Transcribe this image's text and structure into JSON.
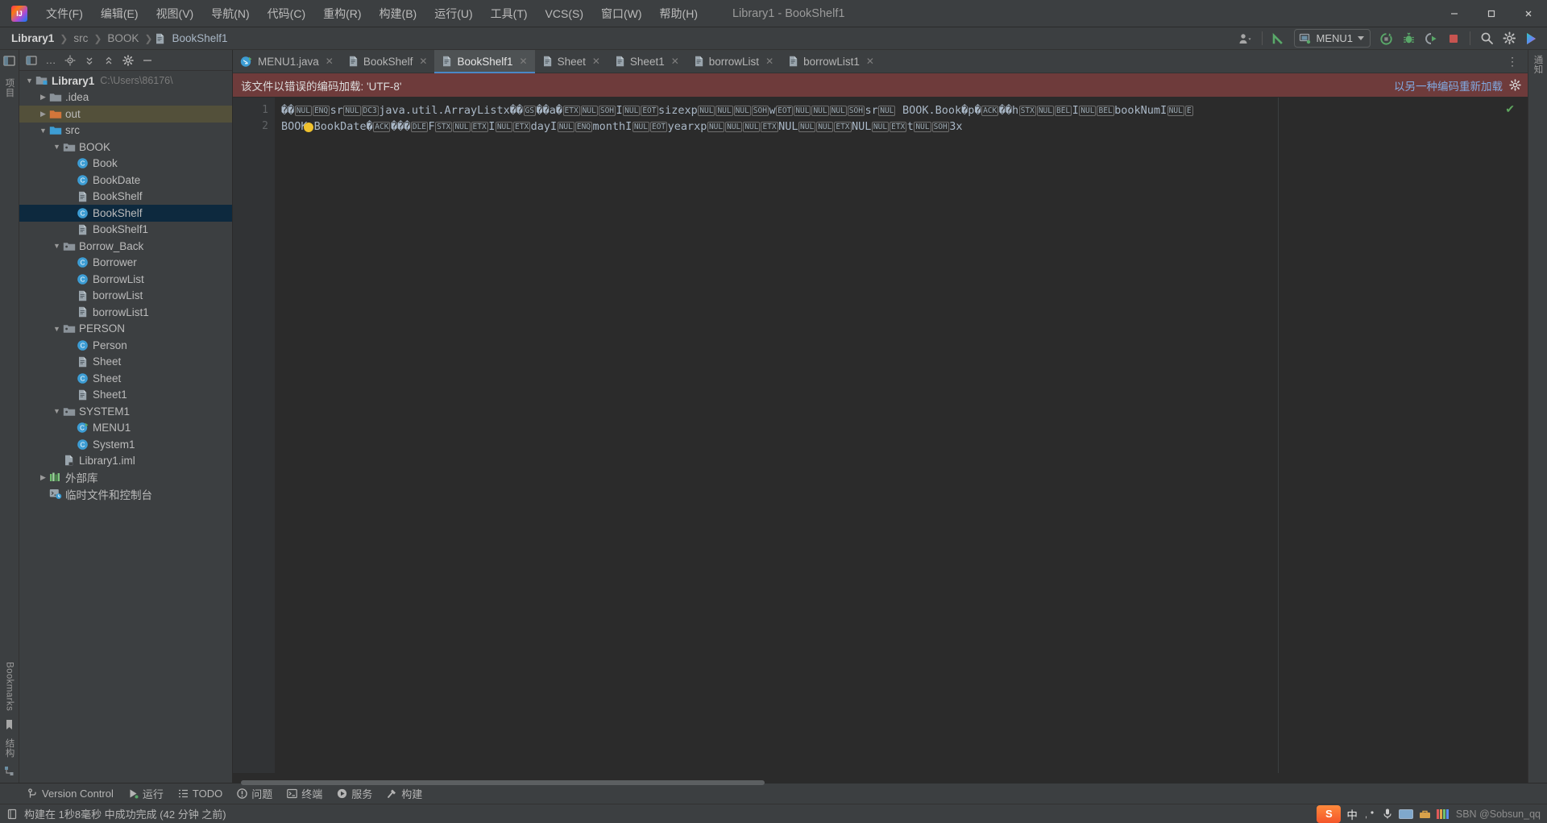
{
  "window": {
    "title": "Library1 - BookShelf1",
    "controls": {
      "minimize": "–",
      "maximize": "□",
      "close": "✕"
    }
  },
  "menubar": {
    "items": [
      {
        "label": "文件(F)"
      },
      {
        "label": "编辑(E)"
      },
      {
        "label": "视图(V)"
      },
      {
        "label": "导航(N)"
      },
      {
        "label": "代码(C)"
      },
      {
        "label": "重构(R)"
      },
      {
        "label": "构建(B)"
      },
      {
        "label": "运行(U)"
      },
      {
        "label": "工具(T)"
      },
      {
        "label": "VCS(S)"
      },
      {
        "label": "窗口(W)"
      },
      {
        "label": "帮助(H)"
      }
    ]
  },
  "navbar": {
    "breadcrumb": [
      "Library1",
      "src",
      "BOOK",
      "BookShelf1"
    ],
    "run_config": "MENU1",
    "icons": [
      "account-icon",
      "updates-arrow-icon",
      "run-icon",
      "debug-icon",
      "run-coverage-icon",
      "stop-icon",
      "search-everywhere-icon",
      "settings-gear-icon",
      "ide-assistant-icon"
    ]
  },
  "project_panel": {
    "toolbar_icons": [
      "project-widget-icon",
      "more-icon",
      "locate-icon",
      "expand-all-icon",
      "collapse-all-icon",
      "settings-icon",
      "hide-icon"
    ],
    "tree": [
      {
        "label": "Library1",
        "path": "C:\\Users\\86176\\",
        "icon": "module-icon",
        "depth": 0,
        "arrow": "down",
        "bold": true,
        "state": "normal"
      },
      {
        "label": ".idea",
        "path": "",
        "icon": "folder-icon",
        "depth": 1,
        "arrow": "right",
        "bold": false,
        "state": "normal"
      },
      {
        "label": "out",
        "path": "",
        "icon": "folder-orange-icon",
        "depth": 1,
        "arrow": "right",
        "bold": false,
        "state": "highlight"
      },
      {
        "label": "src",
        "path": "",
        "icon": "source-folder-icon",
        "depth": 1,
        "arrow": "down",
        "bold": false,
        "state": "normal"
      },
      {
        "label": "BOOK",
        "path": "",
        "icon": "package-icon",
        "depth": 2,
        "arrow": "down",
        "bold": false,
        "state": "normal"
      },
      {
        "label": "Book",
        "path": "",
        "icon": "class-icon",
        "depth": 3,
        "arrow": "",
        "bold": false,
        "state": "normal"
      },
      {
        "label": "BookDate",
        "path": "",
        "icon": "class-icon",
        "depth": 3,
        "arrow": "",
        "bold": false,
        "state": "normal"
      },
      {
        "label": "BookShelf",
        "path": "",
        "icon": "file-icon",
        "depth": 3,
        "arrow": "",
        "bold": false,
        "state": "normal"
      },
      {
        "label": "BookShelf",
        "path": "",
        "icon": "class-icon",
        "depth": 3,
        "arrow": "",
        "bold": false,
        "state": "selected"
      },
      {
        "label": "BookShelf1",
        "path": "",
        "icon": "file-icon",
        "depth": 3,
        "arrow": "",
        "bold": false,
        "state": "normal"
      },
      {
        "label": "Borrow_Back",
        "path": "",
        "icon": "package-icon",
        "depth": 2,
        "arrow": "down",
        "bold": false,
        "state": "normal"
      },
      {
        "label": "Borrower",
        "path": "",
        "icon": "class-icon",
        "depth": 3,
        "arrow": "",
        "bold": false,
        "state": "normal"
      },
      {
        "label": "BorrowList",
        "path": "",
        "icon": "class-icon",
        "depth": 3,
        "arrow": "",
        "bold": false,
        "state": "normal"
      },
      {
        "label": "borrowList",
        "path": "",
        "icon": "file-icon",
        "depth": 3,
        "arrow": "",
        "bold": false,
        "state": "normal"
      },
      {
        "label": "borrowList1",
        "path": "",
        "icon": "file-icon",
        "depth": 3,
        "arrow": "",
        "bold": false,
        "state": "normal"
      },
      {
        "label": "PERSON",
        "path": "",
        "icon": "package-icon",
        "depth": 2,
        "arrow": "down",
        "bold": false,
        "state": "normal"
      },
      {
        "label": "Person",
        "path": "",
        "icon": "class-icon",
        "depth": 3,
        "arrow": "",
        "bold": false,
        "state": "normal"
      },
      {
        "label": "Sheet",
        "path": "",
        "icon": "file-icon",
        "depth": 3,
        "arrow": "",
        "bold": false,
        "state": "normal"
      },
      {
        "label": "Sheet",
        "path": "",
        "icon": "class-icon",
        "depth": 3,
        "arrow": "",
        "bold": false,
        "state": "normal"
      },
      {
        "label": "Sheet1",
        "path": "",
        "icon": "file-icon",
        "depth": 3,
        "arrow": "",
        "bold": false,
        "state": "normal"
      },
      {
        "label": "SYSTEM1",
        "path": "",
        "icon": "package-icon",
        "depth": 2,
        "arrow": "down",
        "bold": false,
        "state": "normal"
      },
      {
        "label": "MENU1",
        "path": "",
        "icon": "class-run-icon",
        "depth": 3,
        "arrow": "",
        "bold": false,
        "state": "normal"
      },
      {
        "label": "System1",
        "path": "",
        "icon": "class-icon",
        "depth": 3,
        "arrow": "",
        "bold": false,
        "state": "normal"
      },
      {
        "label": "Library1.iml",
        "path": "",
        "icon": "iml-file-icon",
        "depth": 2,
        "arrow": "",
        "bold": false,
        "state": "normal"
      },
      {
        "label": "外部库",
        "path": "",
        "icon": "external-libraries-icon",
        "depth": 1,
        "arrow": "right",
        "bold": false,
        "state": "normal"
      },
      {
        "label": "临时文件和控制台",
        "path": "",
        "icon": "scratches-icon",
        "depth": 1,
        "arrow": "",
        "bold": false,
        "state": "normal"
      }
    ]
  },
  "left_strip": {
    "top_labels": [
      "项目"
    ],
    "bottom_labels": [
      "Bookmarks",
      "结构"
    ]
  },
  "right_strip": {
    "labels": [
      "通知"
    ]
  },
  "editor": {
    "tabs": [
      {
        "label": "MENU1.java",
        "icon": "java-run-icon",
        "active": false
      },
      {
        "label": "BookShelf",
        "icon": "file-icon",
        "active": false
      },
      {
        "label": "BookShelf1",
        "icon": "file-icon",
        "active": true
      },
      {
        "label": "Sheet",
        "icon": "file-icon",
        "active": false
      },
      {
        "label": "Sheet1",
        "icon": "file-icon",
        "active": false
      },
      {
        "label": "borrowList",
        "icon": "file-icon",
        "active": false
      },
      {
        "label": "borrowList1",
        "icon": "file-icon",
        "active": false
      }
    ],
    "banner": {
      "message": "该文件以错误的编码加载: 'UTF-8'",
      "link": "以另一种编码重新加载",
      "gear": "settings-gear-icon"
    },
    "line_numbers": [
      "1",
      "2"
    ],
    "lines": [
      [
        {
          "t": "��",
          "c": false
        },
        {
          "t": "NUL",
          "c": true
        },
        {
          "t": "ENQ",
          "c": true
        },
        {
          "t": "sr",
          "c": false
        },
        {
          "t": "NUL",
          "c": true
        },
        {
          "t": "DC3",
          "c": true
        },
        {
          "t": "java.util.ArrayListx��",
          "c": false
        },
        {
          "t": "GS",
          "c": true
        },
        {
          "t": "��a�",
          "c": false
        },
        {
          "t": "ETX",
          "c": true
        },
        {
          "t": "NUL",
          "c": true
        },
        {
          "t": "SOH",
          "c": true
        },
        {
          "t": "I",
          "c": false
        },
        {
          "t": "NUL",
          "c": true
        },
        {
          "t": "EOT",
          "c": true
        },
        {
          "t": "sizexp",
          "c": false
        },
        {
          "t": "NUL",
          "c": true
        },
        {
          "t": "NUL",
          "c": true
        },
        {
          "t": "NUL",
          "c": true
        },
        {
          "t": "SOH",
          "c": true
        },
        {
          "t": "w",
          "c": false
        },
        {
          "t": "EOT",
          "c": true
        },
        {
          "t": "NUL",
          "c": true
        },
        {
          "t": "NUL",
          "c": true
        },
        {
          "t": "NUL",
          "c": true
        },
        {
          "t": "SOH",
          "c": true
        },
        {
          "t": "sr",
          "c": false
        },
        {
          "t": "NUL",
          "c": true
        },
        {
          "t": " BOOK.Book�p�",
          "c": false
        },
        {
          "t": "ACK",
          "c": true
        },
        {
          "t": "��h",
          "c": false
        },
        {
          "t": "STX",
          "c": true
        },
        {
          "t": "NUL",
          "c": true
        },
        {
          "t": "BEL",
          "c": true
        },
        {
          "t": "I",
          "c": false
        },
        {
          "t": "NUL",
          "c": true
        },
        {
          "t": "BEL",
          "c": true
        },
        {
          "t": "bookNumI",
          "c": false
        },
        {
          "t": "NUL",
          "c": true
        },
        {
          "t": "E",
          "c": true
        }
      ],
      [
        {
          "t": "BOOK.BookDate�",
          "c": false
        },
        {
          "t": "ACK",
          "c": true
        },
        {
          "t": "���",
          "c": false
        },
        {
          "t": "DLE",
          "c": true
        },
        {
          "t": "F",
          "c": false
        },
        {
          "t": "STX",
          "c": true
        },
        {
          "t": "NUL",
          "c": true
        },
        {
          "t": "ETX",
          "c": true
        },
        {
          "t": "I",
          "c": false
        },
        {
          "t": "NUL",
          "c": true
        },
        {
          "t": "ETX",
          "c": true
        },
        {
          "t": "dayI",
          "c": false
        },
        {
          "t": "NUL",
          "c": true
        },
        {
          "t": "ENQ",
          "c": true
        },
        {
          "t": "monthI",
          "c": false
        },
        {
          "t": "NUL",
          "c": true
        },
        {
          "t": "EOT",
          "c": true
        },
        {
          "t": "yearxp",
          "c": false
        },
        {
          "t": "NUL",
          "c": true
        },
        {
          "t": "NUL",
          "c": true
        },
        {
          "t": "NUL",
          "c": true
        },
        {
          "t": "ETX",
          "c": true
        },
        {
          "t": "NUL",
          "c": false
        },
        {
          "t": "NUL",
          "c": true
        },
        {
          "t": "NUL",
          "c": true
        },
        {
          "t": "ETX",
          "c": true
        },
        {
          "t": "NUL",
          "c": false
        },
        {
          "t": "NUL",
          "c": true
        },
        {
          "t": "ETX",
          "c": true
        },
        {
          "t": "t",
          "c": false
        },
        {
          "t": "NUL",
          "c": true
        },
        {
          "t": "SOH",
          "c": true
        },
        {
          "t": "3x",
          "c": false
        }
      ]
    ],
    "inspection_status": "no-errors-check-icon"
  },
  "toolwindow_bar": {
    "items": [
      {
        "label": "Version Control",
        "icon": "vcs-branch-icon"
      },
      {
        "label": "运行",
        "icon": "run-green-icon"
      },
      {
        "label": "TODO",
        "icon": "todo-list-icon"
      },
      {
        "label": "问题",
        "icon": "problems-icon"
      },
      {
        "label": "终端",
        "icon": "terminal-icon"
      },
      {
        "label": "服务",
        "icon": "services-icon"
      },
      {
        "label": "构建",
        "icon": "build-hammer-icon"
      }
    ]
  },
  "statusbar": {
    "message": "构建在 1秒8毫秒 中成功完成 (42 分钟 之前)",
    "icon": "event-log-icon",
    "ime": {
      "logo": "S",
      "mode": "中",
      "items": [
        "comma-icon",
        "mic-icon",
        "keyboard-icon",
        "toolbox-icon",
        "palette-icon"
      ]
    },
    "watermark": "SBN @Sobsun_qq"
  },
  "colors": {
    "bg_panel": "#3c3f41",
    "bg_editor": "#2b2b2b",
    "accent_tab": "#4a88c7",
    "banner_bg": "#6e3b3b",
    "banner_link": "#81a9e0",
    "selection": "#0d293e",
    "out_highlight": "#53503a",
    "icon_class": "#3d9dd4",
    "icon_folder": "#8a9299",
    "icon_folder_orange": "#d2763a",
    "run_green": "#59a869",
    "stop_red": "#c75450"
  }
}
